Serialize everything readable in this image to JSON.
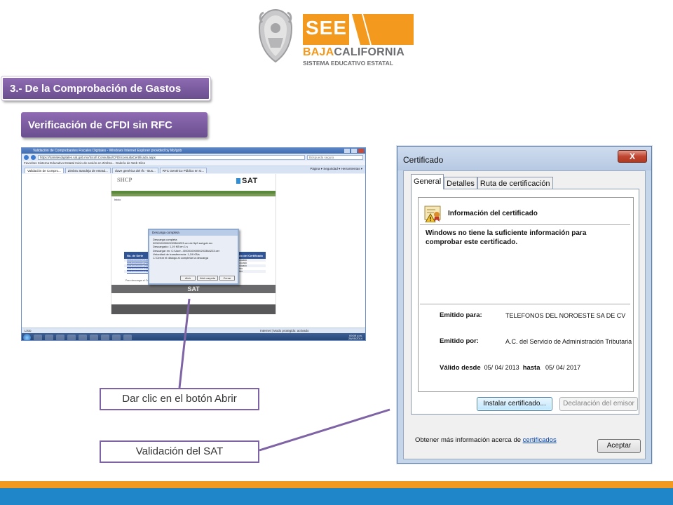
{
  "logo": {
    "see": "SEE",
    "baja": "BAJA",
    "california": "CALIFORNIA",
    "subtitle": "SISTEMA EDUCATIVO ESTATAL",
    "brand_orange": "#f39a1e",
    "brand_gray": "#6d6e71"
  },
  "headings": {
    "section": "3.- De la Comprobación de Gastos",
    "subsection": "Verificación de CFDI sin RFC"
  },
  "browser": {
    "window_title": "Validación de Comprobantes Fiscales Digitales - Windows Internet Explorer provided by Mx/gob",
    "url": "https://tramitesdigitales.sat.gob.mx/Sicofi.Consultas/CFDI/consultaCertificado.aspx",
    "search_placeholder": "Búsqueda segura",
    "favorites_bar": "Favoritos   Sistema Educativo Estatal   Inicio de sesión en Zimbra...   Galería de Web Slice",
    "tabs": [
      "Validación de Compro...",
      "Zimbra: Bandeja de entrad...",
      "clave genérica del rfc - Bus...",
      "RFC Genérico Público en G..."
    ],
    "tools": "Página ▾   Seguridad ▾   Herramientas ▾",
    "sat_page": {
      "shcp": "SHCP",
      "sat": "SAT",
      "inicio": "Inicio",
      "table_header_left": "No. de Serie",
      "table_header_right": "Estado del Certificado",
      "rows": [
        {
          "serie": "00001000000203384225",
          "desde": "2009-05-01 01:34:47",
          "hasta": "2011-05-01 01:34:47",
          "rfc": "TNO6105079G8",
          "estado": "Caducado"
        },
        {
          "serie": "00001000000102986917",
          "desde": "2010-03-10 21:21:23",
          "hasta": "2012-03-10 21:21:23",
          "rfc": "TNO6105079G8",
          "estado": "Caducado"
        },
        {
          "serie": "00001000000102986022",
          "desde": "2011-04-18 23:30:00",
          "hasta": "2013-04-18 23:30:00",
          "rfc": "TNO6105079G8",
          "estado": "Caducado"
        },
        {
          "serie": "00001000000203486992",
          "desde": "2013-03-05 16:28:21",
          "hasta": "2017-03-05 16:28:21",
          "rfc": "TNO6105079G8",
          "estado": "Activo"
        },
        {
          "serie": "00001000000203384223",
          "desde": "2013-04-05 17:00:01",
          "hasta": "2017-04-05 17:00:01",
          "rfc": "TNO6105079G8",
          "estado": "Activo"
        }
      ],
      "caption": "Para descargar el Certificado del Sello Digital, presione sobre el número de serie correspondiente."
    },
    "download_dialog": {
      "title": "Descarga completa",
      "heading": "Descarga completa",
      "file": "00001000000203384223.cer de ftp2.sat.gob.mx",
      "downloaded_label": "Descargado:",
      "downloaded_value": "1,19 KB en 1 s",
      "dest_label": "Descargar en:",
      "dest_value": "C:\\User...\\00001000000203384223.cer",
      "speed_label": "Velocidad de transferencia:",
      "speed_value": "1,19 KB/s",
      "close_checkbox": "Cerrar el diálogo al completar la descarga",
      "btn_open": "Abrir",
      "btn_open_folder": "Abrir carpeta",
      "btn_close": "Cerrar"
    },
    "status_left": "Listo",
    "status_right": "Internet | Modo protegido: activado",
    "clock_time": "09:09 p.m.",
    "clock_date": "28/05/2014"
  },
  "certificate": {
    "title": "Certificado",
    "close_glyph": "X",
    "tabs": [
      "General",
      "Detalles",
      "Ruta de certificación"
    ],
    "info_heading": "Información del certificado",
    "warning": "Windows no tiene la suficiente información para comprobar este certificado.",
    "issued_to_label": "Emitido para:",
    "issued_to": "TELEFONOS DEL NOROESTE SA DE CV",
    "issued_by_label": "Emitido por:",
    "issued_by": "A.C. del Servicio de Administración Tributaria",
    "valid_from_label": "Válido desde",
    "valid_from": "05/ 04/ 2013",
    "valid_to_label": "hasta",
    "valid_to": "05/ 04/ 2017",
    "install_btn": "Instalar certificado...",
    "issuer_statement_btn": "Declaración del emisor",
    "more_info": "Obtener más información acerca de",
    "more_info_link": "certificados",
    "accept_btn": "Aceptar"
  },
  "callouts": {
    "open_button": "Dar clic en el botón Abrir",
    "sat_validation": "Validación del SAT"
  },
  "colors": {
    "banner_purple": "#7a5ca0",
    "callout_border": "#7f64a5",
    "footer_orange": "#f39a1e",
    "footer_blue": "#1f86c9"
  }
}
